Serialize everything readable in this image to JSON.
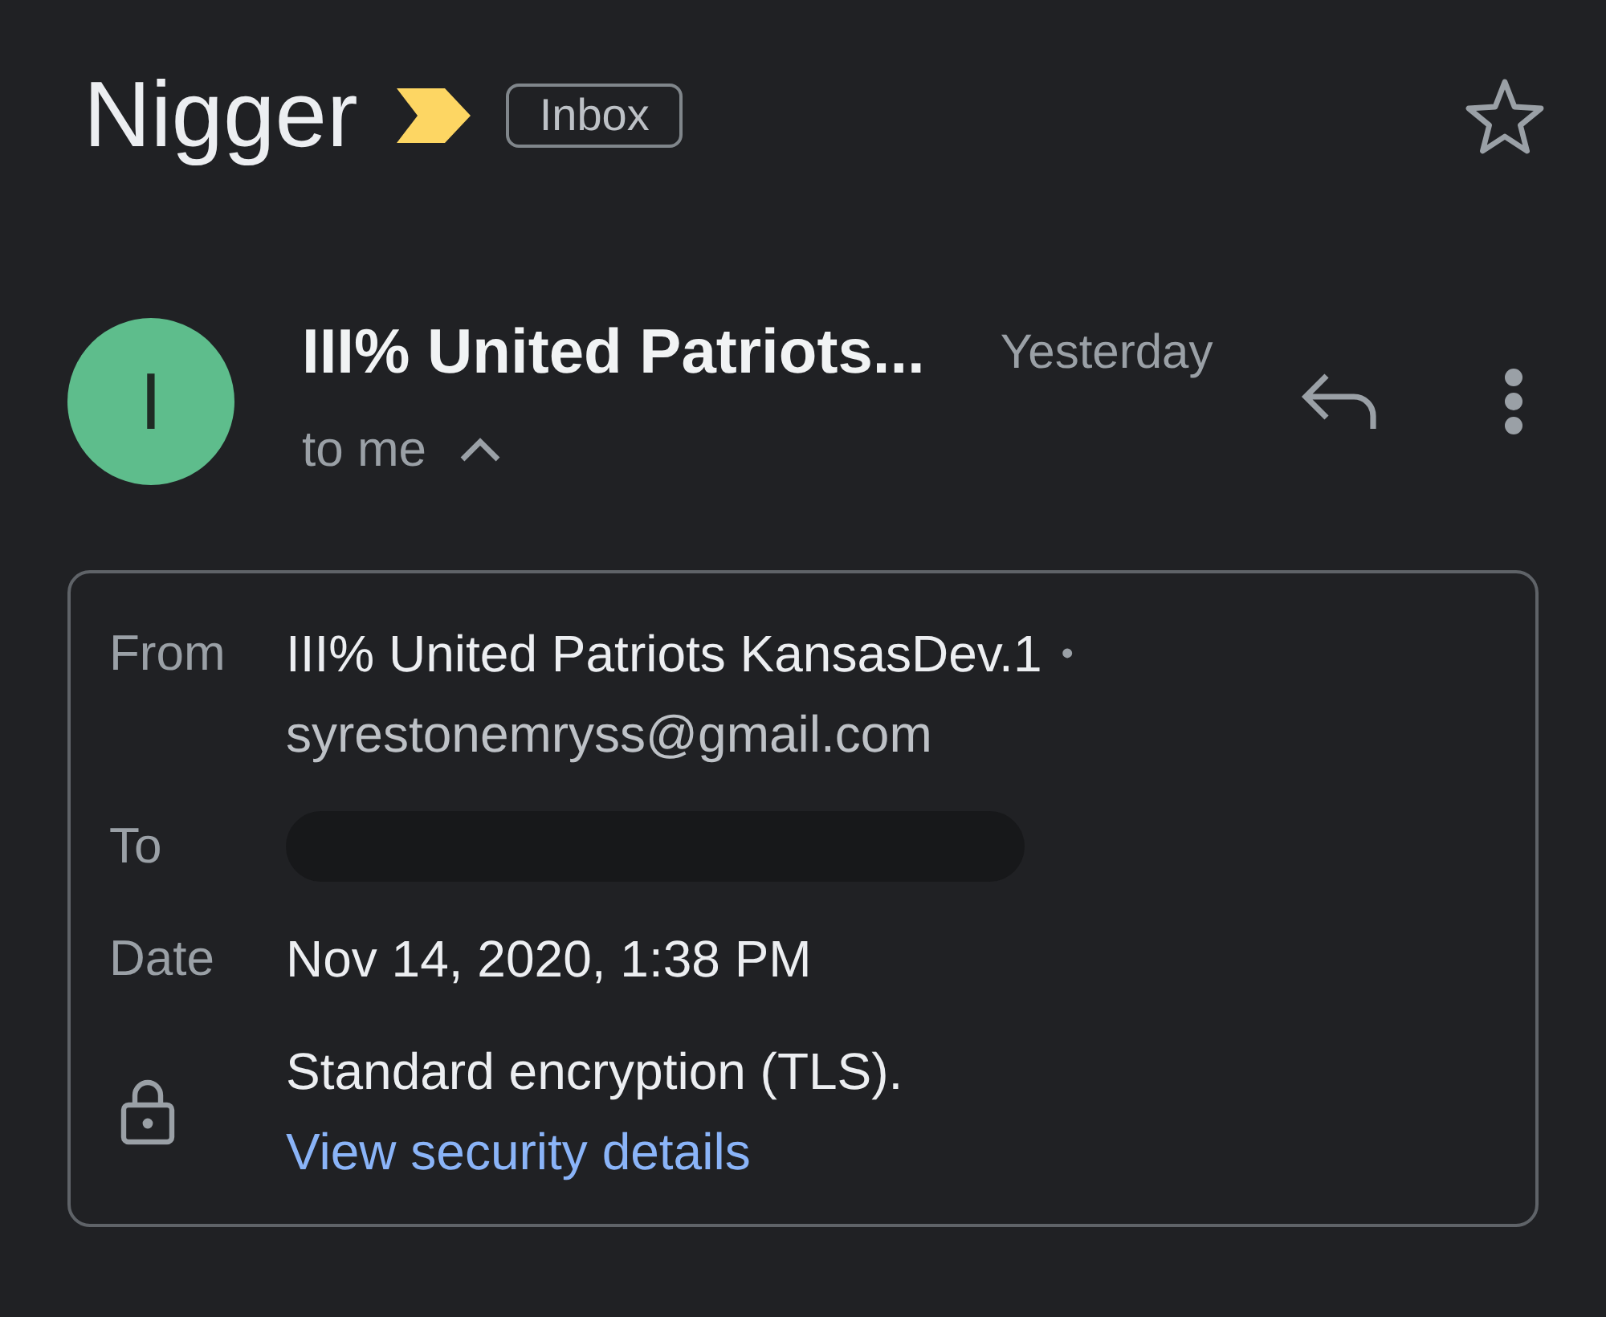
{
  "header": {
    "subject": "Nigger",
    "important": true,
    "label": "Inbox",
    "starred": false
  },
  "message": {
    "avatar_letter": "I",
    "sender": "III% United Patriots...",
    "time": "Yesterday",
    "recipient_summary": "to me",
    "details_expanded": true
  },
  "details": {
    "rows": [
      {
        "kind": "contact",
        "label": "From",
        "value": "III% United Patriots KansasDev.1",
        "separator": "•",
        "secondary": "syrestonemryss@gmail.com"
      },
      {
        "kind": "redacted",
        "label": "To"
      },
      {
        "kind": "text",
        "label": "Date",
        "value": "Nov 14, 2020, 1:38 PM"
      },
      {
        "kind": "security",
        "value": "Standard encryption (TLS).",
        "link": "View security details"
      }
    ]
  }
}
